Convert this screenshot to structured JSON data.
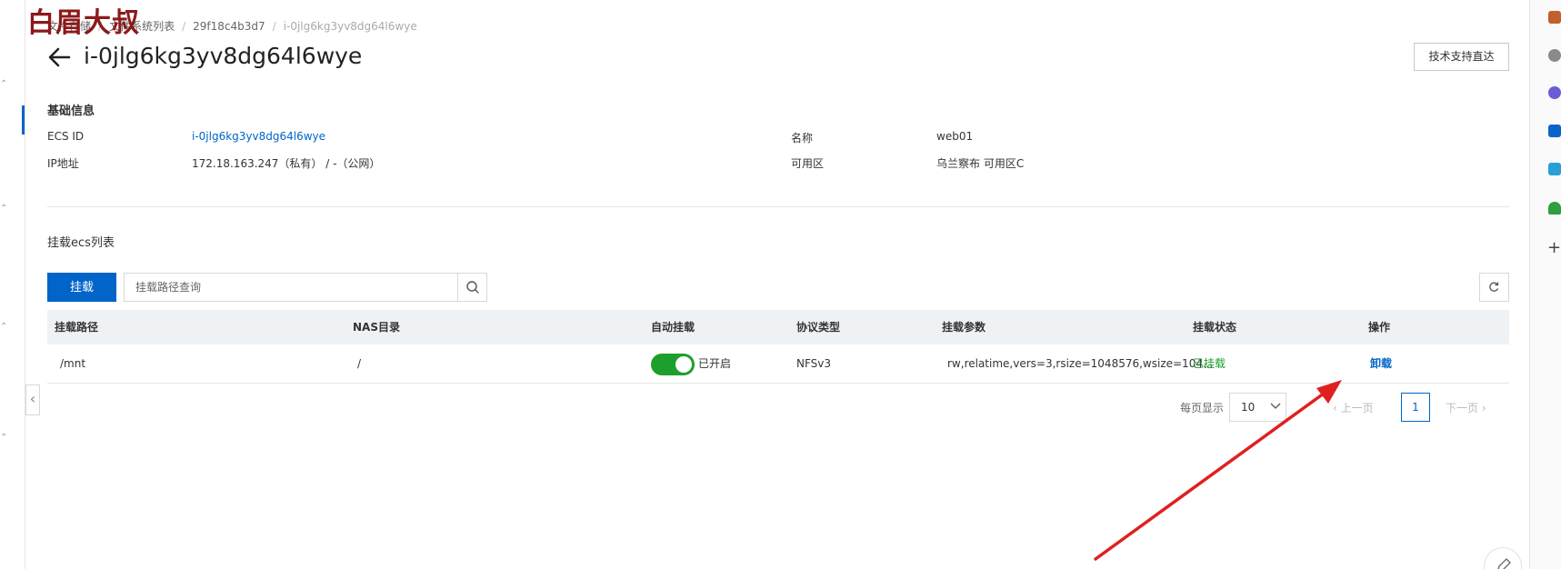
{
  "watermark": "白眉大叔",
  "breadcrumb": {
    "items": [
      "文件存储",
      "文件系统列表",
      "29f18c4b3d7"
    ],
    "current": "i-0jlg6kg3yv8dg64l6wye"
  },
  "header": {
    "title": "i-0jlg6kg3yv8dg64l6wye",
    "support_button": "技术支持直达"
  },
  "basic_info": {
    "section_title": "基础信息",
    "ecs_id_label": "ECS ID",
    "ecs_id_value": "i-0jlg6kg3yv8dg64l6wye",
    "ip_label": "IP地址",
    "ip_value": "172.18.163.247（私有） / -（公网）",
    "name_label": "名称",
    "name_value": "web01",
    "zone_label": "可用区",
    "zone_value": "乌兰察布 可用区C"
  },
  "mount_list": {
    "section_title": "挂载ecs列表",
    "mount_button": "挂载",
    "search_placeholder": "挂载路径查询",
    "columns": [
      "挂载路径",
      "NAS目录",
      "自动挂载",
      "协议类型",
      "挂载参数",
      "挂载状态",
      "操作"
    ],
    "rows": [
      {
        "mount_path": "/mnt",
        "nas_dir": "/",
        "auto_mount_on": true,
        "auto_mount_label": "已开启",
        "protocol": "NFSv3",
        "params": "rw,relatime,vers=3,rsize=1048576,wsize=104...",
        "status": "已挂载",
        "action": "卸载"
      }
    ]
  },
  "pagination": {
    "per_page_label": "每页显示",
    "per_page_value": "10",
    "prev_label": "上一页",
    "current_page": "1",
    "next_label": "下一页"
  },
  "colors": {
    "primary": "#0064c8",
    "success": "#1e9e2c",
    "annotation_arrow": "#e02020"
  }
}
